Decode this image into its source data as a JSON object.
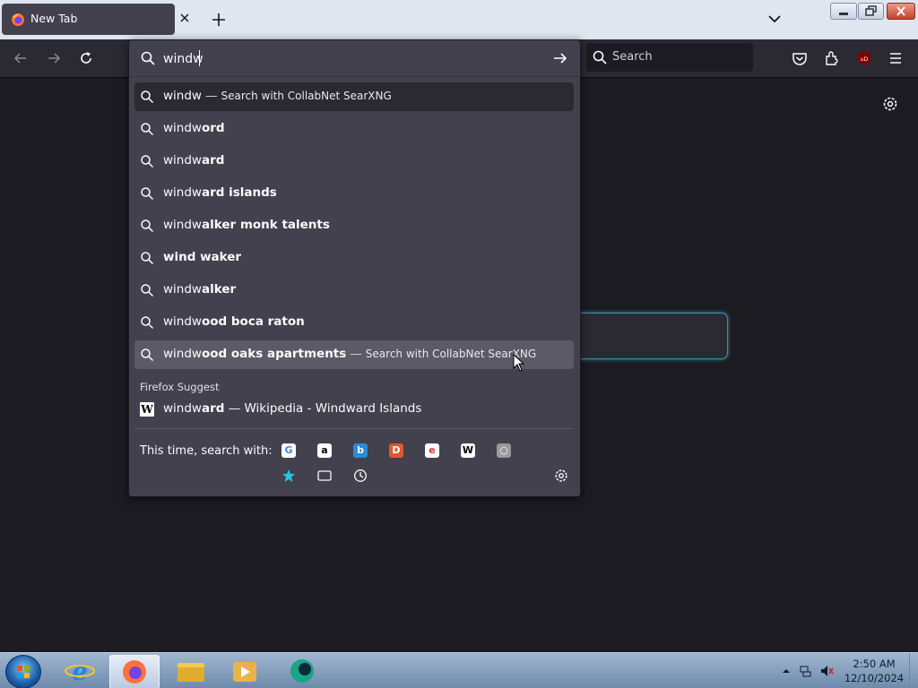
{
  "tab": {
    "title": "New Tab",
    "icon": "firefox-icon"
  },
  "toolbar": {
    "search_placeholder": "Search"
  },
  "urlbar": {
    "value": "windw",
    "suggestions": [
      {
        "plain": "windw",
        "bold": "",
        "suffix": "Search with CollabNet SearXNG",
        "style": "first"
      },
      {
        "plain": "windw",
        "bold": "ord",
        "suffix": ""
      },
      {
        "plain": "windw",
        "bold": "ard",
        "suffix": ""
      },
      {
        "plain": "windw",
        "bold": "ard islands",
        "suffix": ""
      },
      {
        "plain": "windw",
        "bold": "alker monk talents",
        "suffix": ""
      },
      {
        "plain": "",
        "bold": "wind waker",
        "suffix": ""
      },
      {
        "plain": "windw",
        "bold": "alker",
        "suffix": ""
      },
      {
        "plain": "windw",
        "bold": "ood boca raton",
        "suffix": ""
      },
      {
        "plain": "windw",
        "bold": "ood oaks apartments",
        "suffix": "Search with CollabNet SearXNG",
        "style": "highlight"
      }
    ],
    "firefox_suggest_label": "Firefox Suggest",
    "wiki_suggestion": {
      "plain": "windw",
      "bold": "ard",
      "rest": " — Wikipedia - Windward Islands"
    },
    "search_with_label": "This time, search with:",
    "engines": [
      {
        "name": "google-icon",
        "color": "#ffffff"
      },
      {
        "name": "amazon-icon",
        "color": "#ffffff"
      },
      {
        "name": "bing-icon",
        "color": "#2a8bd8"
      },
      {
        "name": "duckduckgo-icon",
        "color": "#de5833"
      },
      {
        "name": "ebay-icon",
        "color": "#ffffff"
      },
      {
        "name": "wikipedia-icon",
        "color": "#ffffff"
      },
      {
        "name": "searx-icon",
        "color": "#9a9a9a"
      }
    ],
    "local_modes": [
      {
        "name": "bookmarks-star-icon",
        "color": "#22c7e6"
      },
      {
        "name": "tabs-icon",
        "color": "#fbfbfe"
      },
      {
        "name": "history-clock-icon",
        "color": "#fbfbfe"
      }
    ]
  },
  "taskbar": {
    "time": "2:50 AM",
    "date": "12/10/2024",
    "items": [
      "ie-icon",
      "firefox-icon",
      "explorer-folder-icon",
      "media-player-icon",
      "app-icon"
    ]
  }
}
